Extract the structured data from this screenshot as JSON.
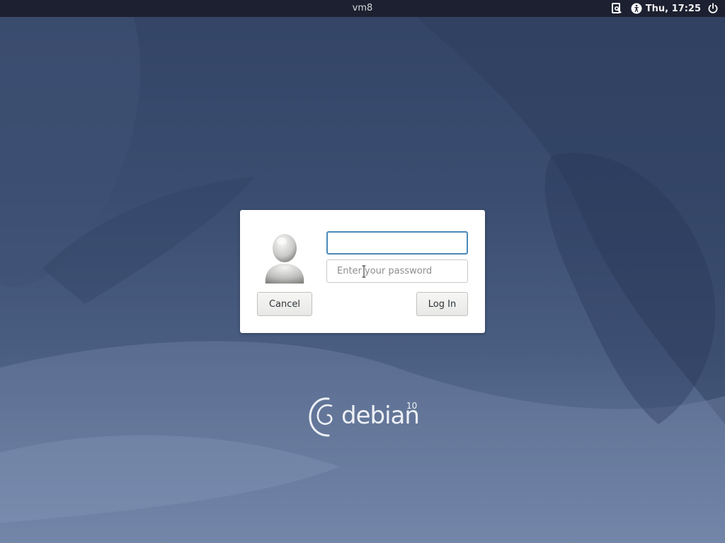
{
  "topbar": {
    "title": "vm8",
    "clock": "Thu, 17:25",
    "icons": [
      "screen-keyboard-icon",
      "accessibility-icon",
      "power-icon"
    ]
  },
  "login": {
    "username_value": "",
    "password_placeholder": "Enter your password",
    "cancel_label": "Cancel",
    "login_label": "Log In"
  },
  "branding": {
    "name": "debian",
    "version": "10"
  },
  "colors": {
    "topbar": "#1d2030",
    "wallpaper_top": "#334466",
    "wallpaper_bottom": "#6f83a6",
    "focus_border": "#4a89b9",
    "dialog_bg": "#ffffff"
  }
}
